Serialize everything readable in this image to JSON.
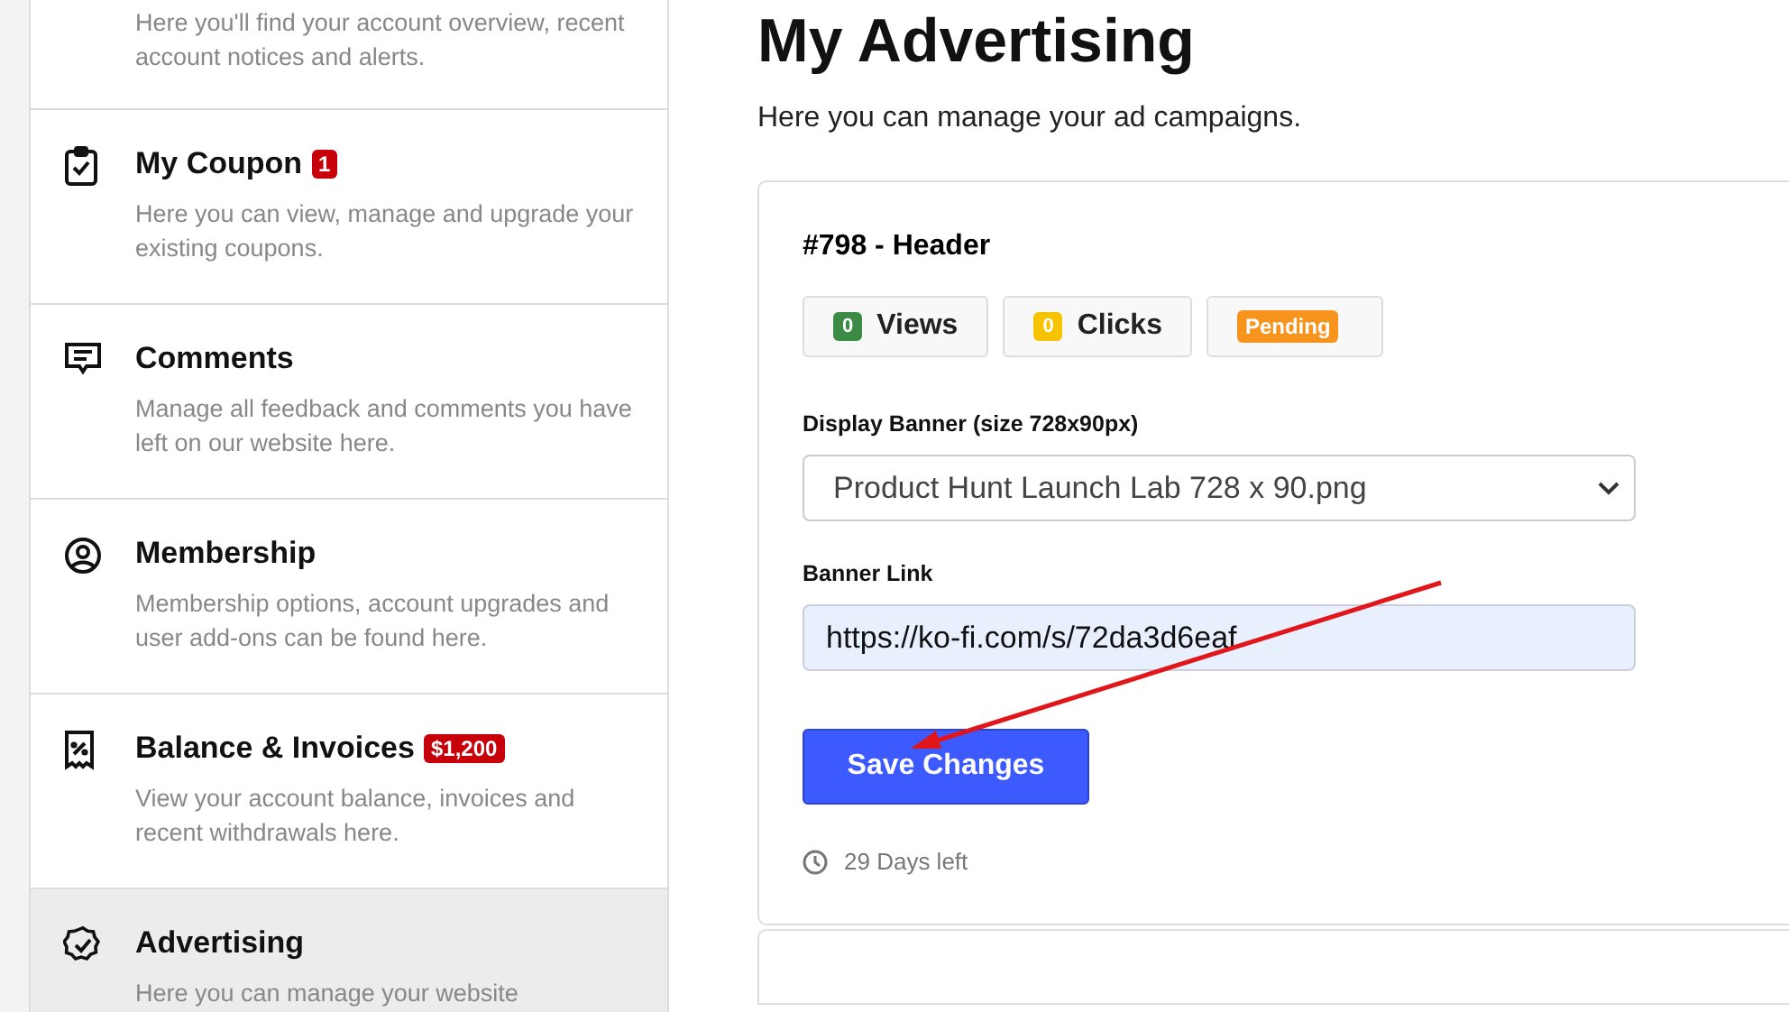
{
  "sidebar": {
    "items": [
      {
        "description": "Here you'll find your account overview, recent account notices and alerts.",
        "selected": false
      },
      {
        "title": "My Coupon",
        "badge": "1",
        "description": "Here you can view, manage and upgrade your existing coupons.",
        "selected": false
      },
      {
        "title": "Comments",
        "description": "Manage all feedback and comments you have left on our website here.",
        "selected": false
      },
      {
        "title": "Membership",
        "description": "Membership options, account upgrades and user add-ons can be found here.",
        "selected": false
      },
      {
        "title": "Balance & Invoices",
        "badge": "$1,200",
        "description": "View your account balance, invoices and recent withdrawals here.",
        "selected": false
      },
      {
        "title": "Advertising",
        "description": "Here you can manage your website",
        "selected": true
      }
    ]
  },
  "page": {
    "title": "My Advertising",
    "subtitle": "Here you can manage your ad campaigns."
  },
  "campaign": {
    "title": "#798 - Header",
    "stats": [
      {
        "kind": "counter",
        "count": "0",
        "label": "Views",
        "color": "#3b8a45"
      },
      {
        "kind": "counter",
        "count": "0",
        "label": "Clicks",
        "color": "#f7c300"
      },
      {
        "kind": "status",
        "label": "Pending",
        "color": "#f7941d"
      }
    ],
    "banner_label": "Display Banner (size 728x90px)",
    "banner_value": "Product Hunt Launch Lab 728 x 90.png",
    "link_label": "Banner Link",
    "link_value": "https://ko-fi.com/s/72da3d6eaf",
    "save_button": "Save Changes",
    "time_left": "29 Days left"
  }
}
